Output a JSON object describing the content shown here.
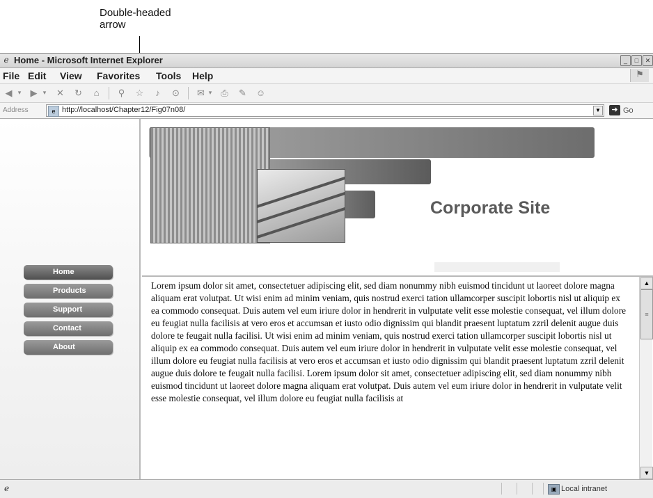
{
  "callout": {
    "line1": "Double-headed",
    "line2": "arrow"
  },
  "window": {
    "title": "Home - Microsoft Internet Explorer"
  },
  "menubar": {
    "items": [
      "File",
      "Edit",
      "View",
      "Favorites",
      "Tools",
      "Help"
    ]
  },
  "toolbar": {
    "icons": [
      "back-icon",
      "forward-icon",
      "stop-icon",
      "refresh-icon",
      "home-icon",
      "search-icon",
      "favorites-icon",
      "media-icon",
      "history-icon",
      "mail-icon",
      "print-icon",
      "edit-icon",
      "messenger-icon"
    ]
  },
  "address": {
    "label": "Address",
    "url": "http://localhost/Chapter12/Fig07n08/",
    "go_label": "Go"
  },
  "nav": {
    "items": [
      "Home",
      "Products",
      "Support",
      "Contact",
      "About"
    ]
  },
  "banner": {
    "title": "Corporate Site"
  },
  "content": {
    "text": "Lorem ipsum dolor sit amet, consectetuer adipiscing elit, sed diam nonummy nibh euismod tincidunt ut laoreet dolore magna aliquam erat volutpat. Ut wisi enim ad minim veniam, quis nostrud exerci tation ullamcorper suscipit lobortis nisl ut aliquip ex ea commodo consequat. Duis autem vel eum iriure dolor in hendrerit in vulputate velit esse molestie consequat, vel illum dolore eu feugiat nulla facilisis at vero eros et accumsan et iusto odio dignissim qui blandit praesent luptatum zzril delenit augue duis dolore te feugait nulla facilisi. Ut wisi enim ad minim veniam, quis nostrud exerci tation ullamcorper suscipit lobortis nisl ut aliquip ex ea commodo consequat. Duis autem vel eum iriure dolor in hendrerit in vulputate velit esse molestie consequat, vel illum dolore eu feugiat nulla facilisis at vero eros et accumsan et iusto odio dignissim qui blandit praesent luptatum zzril delenit augue duis dolore te feugait nulla facilisi. Lorem ipsum dolor sit amet, consectetuer adipiscing elit, sed diam nonummy nibh euismod tincidunt ut laoreet dolore magna aliquam erat volutpat. Duis autem vel eum iriure dolor in hendrerit in vulputate velit esse molestie consequat, vel illum dolore eu feugiat nulla facilisis at"
  },
  "status": {
    "zone": "Local intranet"
  }
}
